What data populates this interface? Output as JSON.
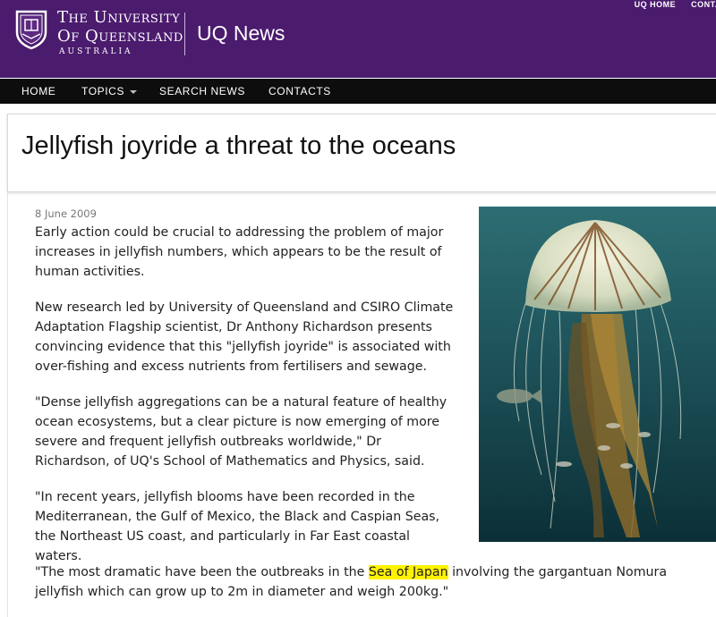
{
  "header": {
    "university_line1": "The University",
    "university_line2": "Of Queensland",
    "university_line3": "AUSTRALIA",
    "site_title": "UQ News",
    "utility_links": [
      "UQ HOME",
      "CONTA"
    ]
  },
  "nav": {
    "items": [
      {
        "label": "HOME"
      },
      {
        "label": "TOPICS"
      },
      {
        "label": "SEARCH NEWS"
      },
      {
        "label": "CONTACTS"
      }
    ]
  },
  "article": {
    "title": "Jellyfish joyride a threat to the oceans",
    "date": "8 June 2009",
    "p1": "Early action could be crucial to addressing the problem of major increases in jellyfish numbers, which appears to be the result of human activities.",
    "p2": "New research led by University of Queensland and CSIRO Climate Adaptation Flagship scientist, Dr Anthony Richardson presents convincing evidence that this \"jellyfish joyride\" is associated with over-fishing and excess nutrients from fertilisers and sewage.",
    "p3": "\"Dense jellyfish aggregations can be a natural feature of healthy ocean ecosystems, but a clear picture is now emerging of more severe and frequent jellyfish outbreaks worldwide,\" Dr Richardson, of UQ's School of Mathematics and Physics, said.",
    "p4": "\"In recent years, jellyfish blooms have been recorded in the Mediterranean, the Gulf of Mexico, the Black and Caspian Seas, the Northeast US coast, and particularly in Far East coastal waters.",
    "p5_before": "\"The most dramatic have been the outbreaks in the ",
    "p5_highlight": "Sea of Japan",
    "p5_after": " involving the gargantuan Nomura jellyfish which can grow up to 2m in diameter and weigh 200kg.\""
  },
  "colors": {
    "header_purple": "#4b1b6e",
    "nav_black": "#0d0d0d",
    "highlight": "#fff200"
  },
  "icons": {
    "crest": "uq-crest-icon",
    "caret": "chevron-down-icon"
  }
}
